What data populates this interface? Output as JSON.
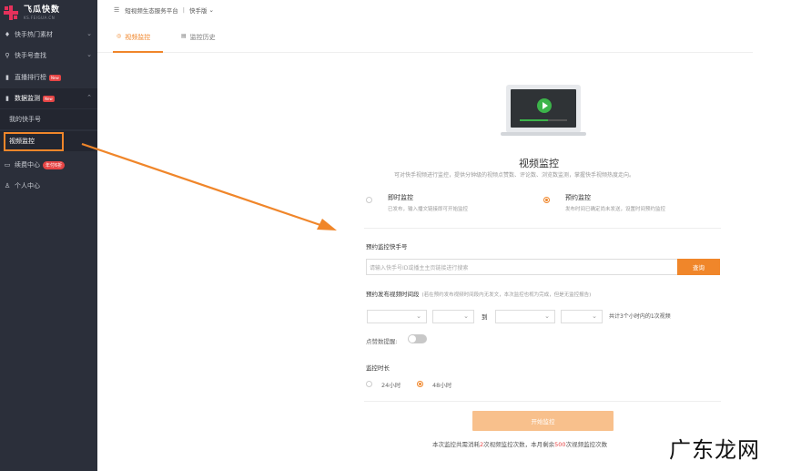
{
  "app": {
    "logo_name": "飞瓜快数",
    "logo_sub": "KS.FEIGUA.CN"
  },
  "header": {
    "platform": "短视频生态服务平台",
    "separator": "|",
    "version": "快手版"
  },
  "sidebar": {
    "items": [
      {
        "label": "快手热门素材",
        "icon": "fire-icon"
      },
      {
        "label": "快手号查找",
        "icon": "search-icon"
      },
      {
        "label": "直播排行榜",
        "icon": "bar-chart-icon",
        "badge": "New"
      },
      {
        "label": "数据监测",
        "icon": "bar-chart-icon",
        "badge": "New"
      },
      {
        "label": "我的快手号"
      },
      {
        "label": "视频监控"
      },
      {
        "label": "续费中心",
        "icon": "card-icon",
        "badge": "年付6折"
      },
      {
        "label": "个人中心",
        "icon": "user-icon"
      }
    ]
  },
  "tabs": [
    {
      "label": "视频监控",
      "icon": "clock-icon",
      "active": true
    },
    {
      "label": "监控历史",
      "icon": "history-icon",
      "active": false
    }
  ],
  "main": {
    "title": "视频监控",
    "subtitle": "可对快手视频进行监控，提供分钟级的视频点赞数、评论数、浏览数监测，掌握快手视频热度走向。",
    "video_progress": 0.6,
    "modes": [
      {
        "title": "即时监控",
        "desc": "已发布，输入播文链接即可开始监控",
        "selected": false
      },
      {
        "title": "预约监控",
        "desc": "发布时间已确定尚未发送，设置时间预约监控",
        "selected": true
      }
    ],
    "account_label": "预约监控快手号",
    "search_placeholder": "请输入快手号ID或播主主页链接进行搜索",
    "search_button": "查询",
    "time_label": "预约发布视频时间段",
    "time_hint": "(若在预约发布视频时间段内无发文，本次监控也视为完成，但是无监控报告)",
    "to_label": "到",
    "count_text": "共计3个小时内的1次视频",
    "like_alert_label": "点赞数提醒:",
    "like_alert_on": false,
    "duration_label": "监控时长",
    "durations": [
      {
        "label": "24小时",
        "selected": false
      },
      {
        "label": "48小时",
        "selected": true
      }
    ],
    "start_button": "开始监控",
    "footer_prefix": "本次监控共需消耗",
    "footer_cost": "2",
    "footer_middle": "次视频监控次数，本月剩余",
    "footer_remaining": "500",
    "footer_suffix": "次视频监控次数"
  },
  "watermark": "广东龙网",
  "colors": {
    "accent": "#f0862a",
    "sidebar_bg": "#2b2f3a",
    "badge_red": "#e64545",
    "play_green": "#3cb44a"
  }
}
